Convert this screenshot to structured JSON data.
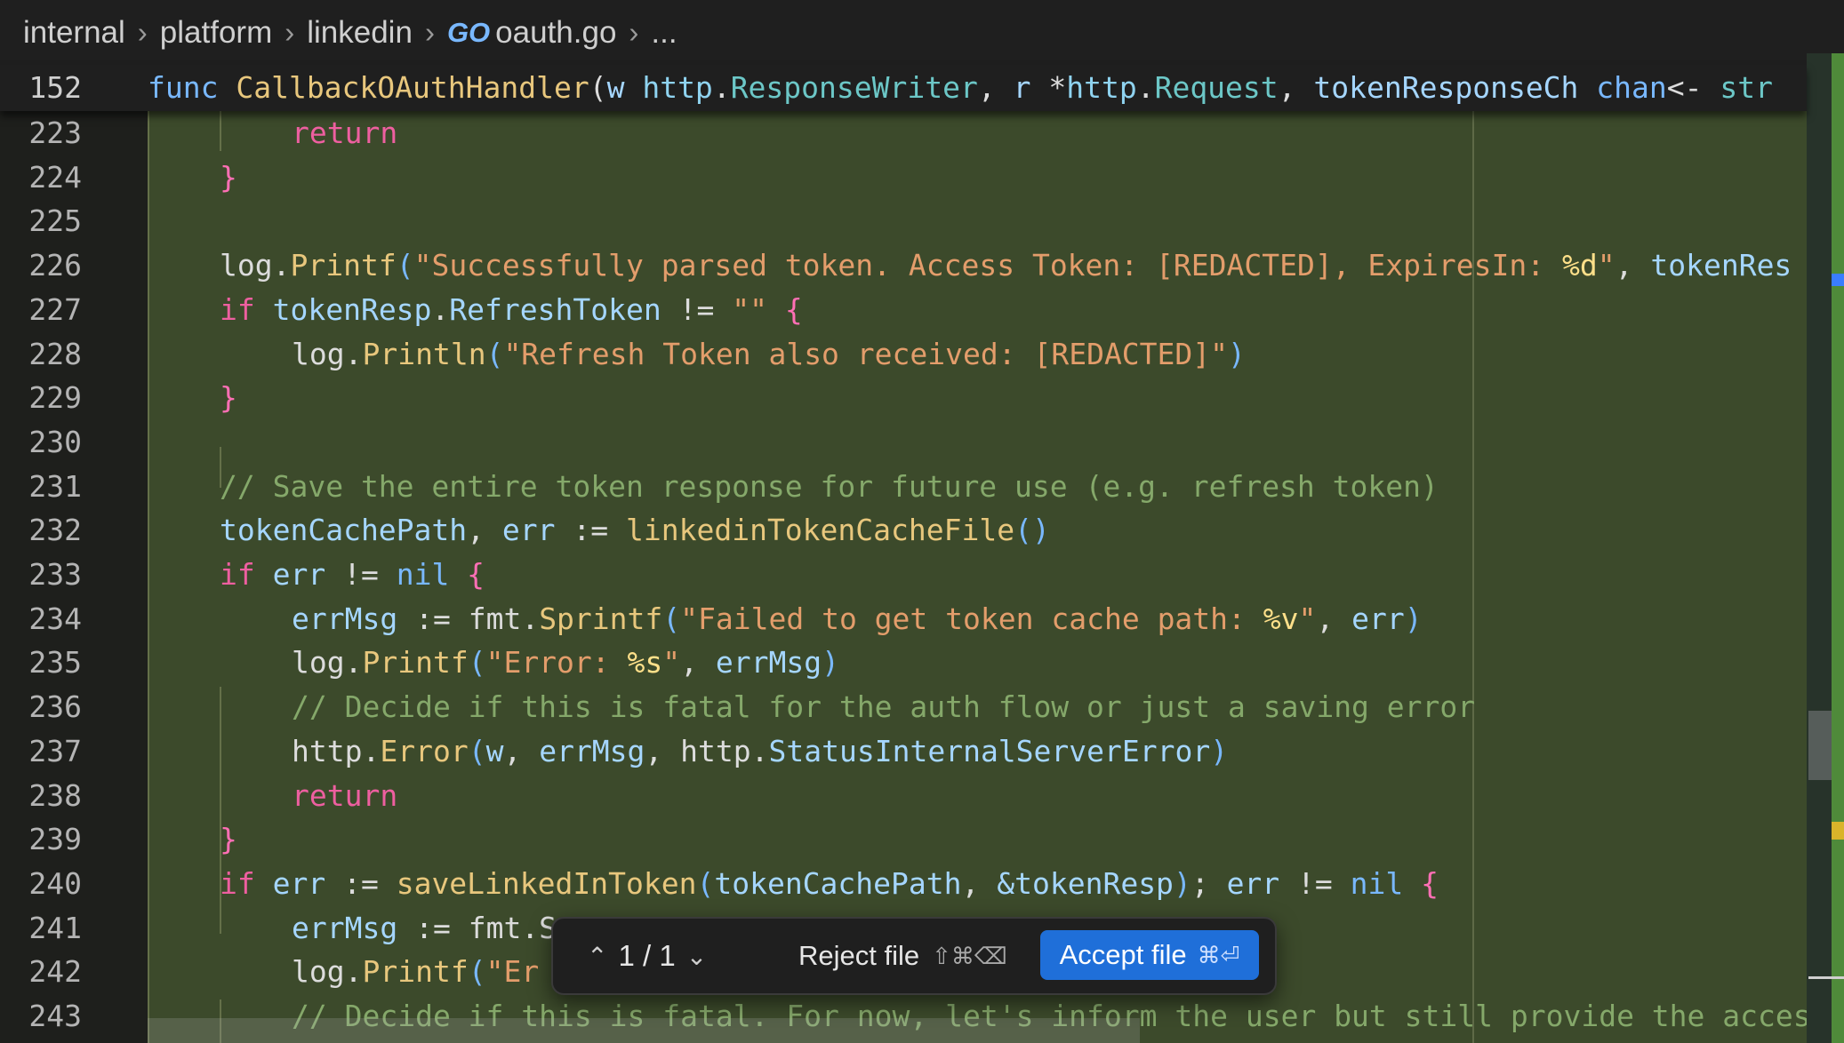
{
  "breadcrumb": {
    "items": [
      "internal",
      "platform",
      "linkedin",
      "oauth.go",
      "..."
    ],
    "file_icon": "GO"
  },
  "sticky_line": {
    "number": "152",
    "tokens": [
      {
        "t": "func ",
        "c": "par"
      },
      {
        "t": "CallbackOAuthHandler",
        "c": "fn"
      },
      {
        "t": "(",
        "c": "pl"
      },
      {
        "t": "w ",
        "c": "var"
      },
      {
        "t": "http",
        "c": "ty2"
      },
      {
        "t": ".",
        "c": "pl"
      },
      {
        "t": "ResponseWriter",
        "c": "typ"
      },
      {
        "t": ", ",
        "c": "pl"
      },
      {
        "t": "r ",
        "c": "var"
      },
      {
        "t": "*",
        "c": "pl"
      },
      {
        "t": "http",
        "c": "ty2"
      },
      {
        "t": ".",
        "c": "pl"
      },
      {
        "t": "Request",
        "c": "typ"
      },
      {
        "t": ", ",
        "c": "pl"
      },
      {
        "t": "tokenResponseCh ",
        "c": "var"
      },
      {
        "t": "chan",
        "c": "par"
      },
      {
        "t": "<- ",
        "c": "pl"
      },
      {
        "t": "str",
        "c": "typ"
      }
    ]
  },
  "lines": [
    {
      "n": "223",
      "indent": 2,
      "tokens": [
        {
          "t": "return",
          "c": "kw"
        }
      ]
    },
    {
      "n": "224",
      "indent": 1,
      "tokens": [
        {
          "t": "}",
          "c": "brc"
        }
      ]
    },
    {
      "n": "225",
      "indent": 0,
      "tokens": []
    },
    {
      "n": "226",
      "indent": 1,
      "tokens": [
        {
          "t": "log",
          "c": "pl"
        },
        {
          "t": ".",
          "c": "pl"
        },
        {
          "t": "Printf",
          "c": "fn"
        },
        {
          "t": "(",
          "c": "par"
        },
        {
          "t": "\"Successfully parsed token. Access Token: [REDACTED], ExpiresIn: ",
          "c": "str"
        },
        {
          "t": "%d",
          "c": "fmt"
        },
        {
          "t": "\"",
          "c": "str"
        },
        {
          "t": ", ",
          "c": "pl"
        },
        {
          "t": "tokenRes",
          "c": "var"
        }
      ]
    },
    {
      "n": "227",
      "indent": 1,
      "tokens": [
        {
          "t": "if ",
          "c": "kw"
        },
        {
          "t": "tokenResp",
          "c": "var"
        },
        {
          "t": ".",
          "c": "pl"
        },
        {
          "t": "RefreshToken",
          "c": "var"
        },
        {
          "t": " != ",
          "c": "pl"
        },
        {
          "t": "\"\"",
          "c": "str"
        },
        {
          "t": " {",
          "c": "brc"
        }
      ]
    },
    {
      "n": "228",
      "indent": 2,
      "tokens": [
        {
          "t": "log",
          "c": "pl"
        },
        {
          "t": ".",
          "c": "pl"
        },
        {
          "t": "Println",
          "c": "fn"
        },
        {
          "t": "(",
          "c": "par"
        },
        {
          "t": "\"Refresh Token also received: [REDACTED]\"",
          "c": "str"
        },
        {
          "t": ")",
          "c": "par"
        }
      ]
    },
    {
      "n": "229",
      "indent": 1,
      "tokens": [
        {
          "t": "}",
          "c": "brc"
        }
      ]
    },
    {
      "n": "230",
      "indent": 0,
      "tokens": []
    },
    {
      "n": "231",
      "indent": 1,
      "tokens": [
        {
          "t": "// Save the entire token response for future use (e.g. refresh token)",
          "c": "cmt"
        }
      ]
    },
    {
      "n": "232",
      "indent": 1,
      "tokens": [
        {
          "t": "tokenCachePath",
          "c": "var"
        },
        {
          "t": ", ",
          "c": "pl"
        },
        {
          "t": "err",
          "c": "var"
        },
        {
          "t": " := ",
          "c": "pl"
        },
        {
          "t": "linkedinTokenCacheFile",
          "c": "fn"
        },
        {
          "t": "()",
          "c": "par"
        }
      ]
    },
    {
      "n": "233",
      "indent": 1,
      "tokens": [
        {
          "t": "if ",
          "c": "kw"
        },
        {
          "t": "err",
          "c": "var"
        },
        {
          "t": " != ",
          "c": "pl"
        },
        {
          "t": "nil",
          "c": "nil"
        },
        {
          "t": " {",
          "c": "brc"
        }
      ]
    },
    {
      "n": "234",
      "indent": 2,
      "tokens": [
        {
          "t": "errMsg",
          "c": "var"
        },
        {
          "t": " := ",
          "c": "pl"
        },
        {
          "t": "fmt",
          "c": "pl"
        },
        {
          "t": ".",
          "c": "pl"
        },
        {
          "t": "Sprintf",
          "c": "fn"
        },
        {
          "t": "(",
          "c": "par"
        },
        {
          "t": "\"Failed to get token cache path: ",
          "c": "str"
        },
        {
          "t": "%v",
          "c": "fmt"
        },
        {
          "t": "\"",
          "c": "str"
        },
        {
          "t": ", ",
          "c": "pl"
        },
        {
          "t": "err",
          "c": "var"
        },
        {
          "t": ")",
          "c": "par"
        }
      ]
    },
    {
      "n": "235",
      "indent": 2,
      "tokens": [
        {
          "t": "log",
          "c": "pl"
        },
        {
          "t": ".",
          "c": "pl"
        },
        {
          "t": "Printf",
          "c": "fn"
        },
        {
          "t": "(",
          "c": "par"
        },
        {
          "t": "\"Error: ",
          "c": "str"
        },
        {
          "t": "%s",
          "c": "fmt"
        },
        {
          "t": "\"",
          "c": "str"
        },
        {
          "t": ", ",
          "c": "pl"
        },
        {
          "t": "errMsg",
          "c": "var"
        },
        {
          "t": ")",
          "c": "par"
        }
      ]
    },
    {
      "n": "236",
      "indent": 2,
      "tokens": [
        {
          "t": "// Decide if this is fatal for the auth flow or just a saving error",
          "c": "cmt"
        }
      ]
    },
    {
      "n": "237",
      "indent": 2,
      "tokens": [
        {
          "t": "http",
          "c": "pl"
        },
        {
          "t": ".",
          "c": "pl"
        },
        {
          "t": "Error",
          "c": "fn"
        },
        {
          "t": "(",
          "c": "par"
        },
        {
          "t": "w",
          "c": "var"
        },
        {
          "t": ", ",
          "c": "pl"
        },
        {
          "t": "errMsg",
          "c": "var"
        },
        {
          "t": ", ",
          "c": "pl"
        },
        {
          "t": "http",
          "c": "pl"
        },
        {
          "t": ".",
          "c": "pl"
        },
        {
          "t": "StatusInternalServerError",
          "c": "var"
        },
        {
          "t": ")",
          "c": "par"
        }
      ]
    },
    {
      "n": "238",
      "indent": 2,
      "tokens": [
        {
          "t": "return",
          "c": "kw"
        }
      ]
    },
    {
      "n": "239",
      "indent": 1,
      "tokens": [
        {
          "t": "}",
          "c": "brc"
        }
      ]
    },
    {
      "n": "240",
      "indent": 1,
      "tokens": [
        {
          "t": "if ",
          "c": "kw"
        },
        {
          "t": "err",
          "c": "var"
        },
        {
          "t": " := ",
          "c": "pl"
        },
        {
          "t": "saveLinkedInToken",
          "c": "fn"
        },
        {
          "t": "(",
          "c": "par"
        },
        {
          "t": "tokenCachePath",
          "c": "var"
        },
        {
          "t": ", ",
          "c": "pl"
        },
        {
          "t": "&tokenResp",
          "c": "var"
        },
        {
          "t": ")",
          "c": "par"
        },
        {
          "t": "; ",
          "c": "pl"
        },
        {
          "t": "err",
          "c": "var"
        },
        {
          "t": " != ",
          "c": "pl"
        },
        {
          "t": "nil",
          "c": "nil"
        },
        {
          "t": " {",
          "c": "brc"
        }
      ]
    },
    {
      "n": "241",
      "indent": 2,
      "tokens": [
        {
          "t": "errMsg",
          "c": "var"
        },
        {
          "t": " := ",
          "c": "pl"
        },
        {
          "t": "fmt.S",
          "c": "pl"
        }
      ]
    },
    {
      "n": "242",
      "indent": 2,
      "tokens": [
        {
          "t": "log",
          "c": "pl"
        },
        {
          "t": ".",
          "c": "pl"
        },
        {
          "t": "Printf",
          "c": "fn"
        },
        {
          "t": "(",
          "c": "par"
        },
        {
          "t": "\"Er",
          "c": "str"
        }
      ]
    },
    {
      "n": "243",
      "indent": 2,
      "tokens": [
        {
          "t": "// Decide if this is fatal. For now, let's inform the user but still provide the acces",
          "c": "cmt"
        }
      ]
    }
  ],
  "review": {
    "counter": "1 / 1",
    "reject_label": "Reject file",
    "reject_shortcut": "⇧⌘⌫",
    "accept_label": "Accept file",
    "accept_shortcut": "⌘⏎"
  }
}
